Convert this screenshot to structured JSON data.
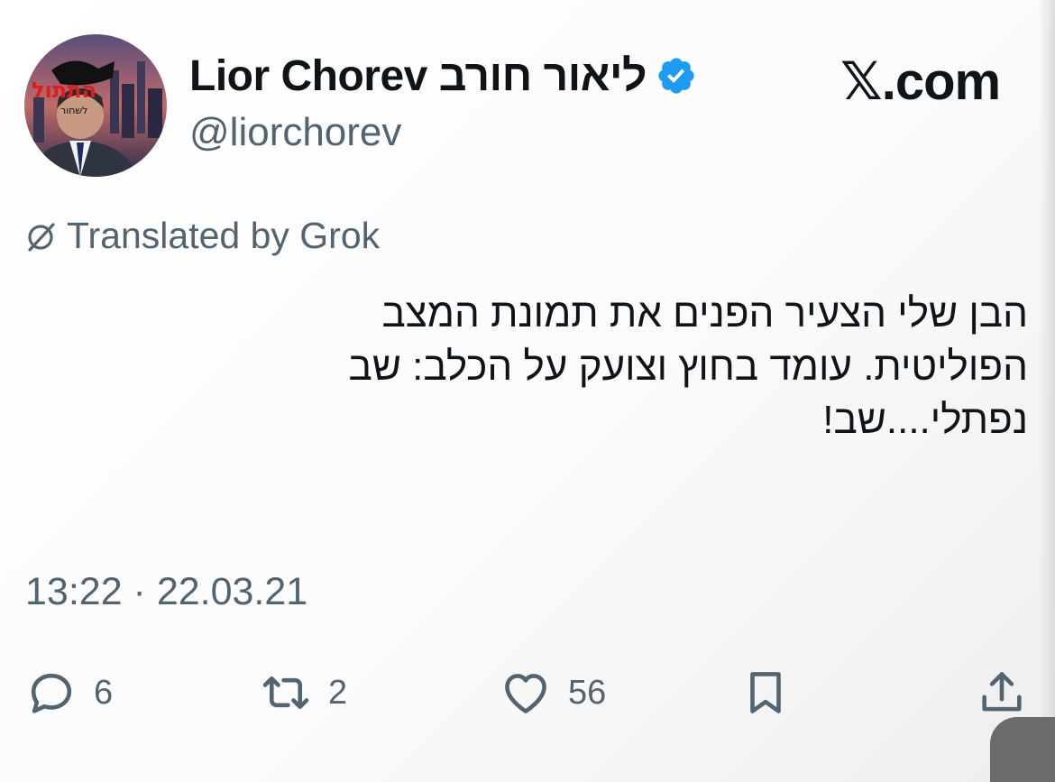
{
  "author": {
    "display_name": "Lior Chorev ליאור חורב",
    "handle": "@liorchorev",
    "avatar_overlay_text": "התתול",
    "avatar_overlay_subtext": "לשחור"
  },
  "brand": {
    "logo_text": "𝕏.com"
  },
  "translation": {
    "label": "Translated by Grok"
  },
  "tweet": {
    "lines": [
      "הבן שלי הצעיר הפנים את תמונת המצב",
      "הפוליטית.  עומד בחוץ וצועק על הכלב: שב",
      "נפתלי....שב!"
    ],
    "timestamp": "13:22 · 22.03.21"
  },
  "actions": {
    "replies": "6",
    "reposts": "2",
    "likes": "56"
  },
  "icons": {
    "verified": "verified-badge-icon",
    "grok": "grok-icon",
    "reply": "reply-icon",
    "repost": "repost-icon",
    "like": "heart-icon",
    "bookmark": "bookmark-icon",
    "share": "share-icon"
  },
  "colors": {
    "verified_blue": "#1d9bf0",
    "secondary_text": "#536471",
    "primary_text": "#0f1419"
  }
}
